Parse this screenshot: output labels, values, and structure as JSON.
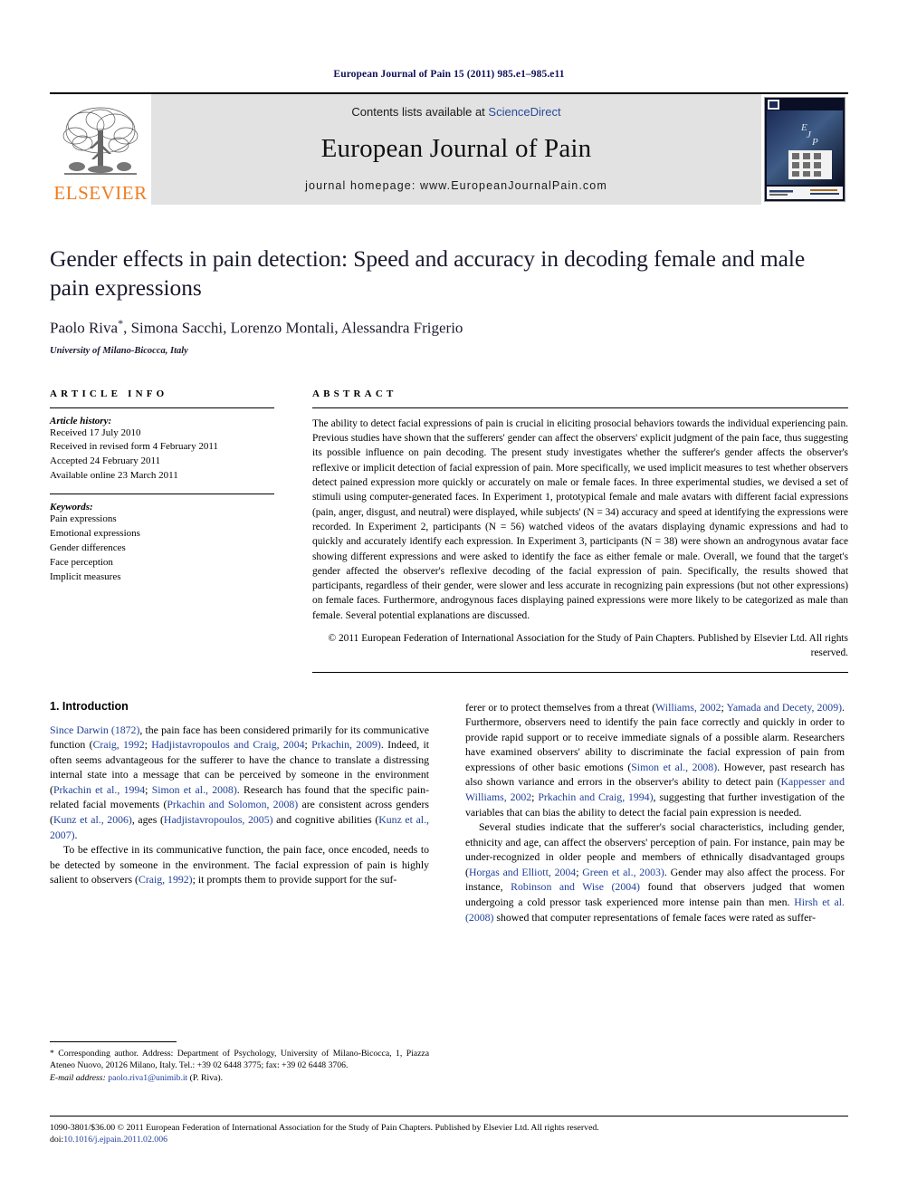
{
  "running_head": "European Journal of Pain 15 (2011) 985.e1–985.e11",
  "masthead": {
    "publisher_name": "ELSEVIER",
    "contents_prefix": "Contents lists available at ",
    "contents_link": "ScienceDirect",
    "journal_name": "European Journal of Pain",
    "homepage": "journal homepage: www.EuropeanJournalPain.com",
    "cover_title_lines": [
      "European",
      "Journal of",
      "Pain"
    ],
    "cover_acronym": "EJP"
  },
  "article": {
    "title": "Gender effects in pain detection: Speed and accuracy in decoding female and male pain expressions",
    "authors": "Paolo Riva",
    "authors_rest": ", Simona Sacchi, Lorenzo Montali, Alessandra Frigerio",
    "corresponding_marker": "*",
    "affiliation": "University of Milano-Bicocca, Italy"
  },
  "article_info": {
    "heading": "ARTICLE INFO",
    "history_label": "Article history:",
    "history": [
      "Received 17 July 2010",
      "Received in revised form 4 February 2011",
      "Accepted 24 February 2011",
      "Available online 23 March 2011"
    ],
    "keywords_label": "Keywords:",
    "keywords": [
      "Pain expressions",
      "Emotional expressions",
      "Gender differences",
      "Face perception",
      "Implicit measures"
    ]
  },
  "abstract": {
    "heading": "ABSTRACT",
    "text": "The ability to detect facial expressions of pain is crucial in eliciting prosocial behaviors towards the individual experiencing pain. Previous studies have shown that the sufferers' gender can affect the observers' explicit judgment of the pain face, thus suggesting its possible influence on pain decoding. The present study investigates whether the sufferer's gender affects the observer's reflexive or implicit detection of facial expression of pain. More specifically, we used implicit measures to test whether observers detect pained expression more quickly or accurately on male or female faces. In three experimental studies, we devised a set of stimuli using computer-generated faces. In Experiment 1, prototypical female and male avatars with different facial expressions (pain, anger, disgust, and neutral) were displayed, while subjects' (N = 34) accuracy and speed at identifying the expressions were recorded. In Experiment 2, participants (N = 56) watched videos of the avatars displaying dynamic expressions and had to quickly and accurately identify each expression. In Experiment 3, participants (N = 38) were shown an androgynous avatar face showing different expressions and were asked to identify the face as either female or male. Overall, we found that the target's gender affected the observer's reflexive decoding of the facial expression of pain. Specifically, the results showed that participants, regardless of their gender, were slower and less accurate in recognizing pain expressions (but not other expressions) on female faces. Furthermore, androgynous faces displaying pained expressions were more likely to be categorized as male than female. Several potential explanations are discussed.",
    "copyright": "© 2011 European Federation of International Association for the Study of Pain Chapters. Published by Elsevier Ltd. All rights reserved."
  },
  "introduction": {
    "heading": "1. Introduction",
    "left_paragraphs": [
      "Since Darwin (1872), the pain face has been considered primarily for its communicative function (Craig, 1992; Hadjistavropoulos and Craig, 2004; Prkachin, 2009). Indeed, it often seems advantageous for the sufferer to have the chance to translate a distressing internal state into a message that can be perceived by someone in the environment (Prkachin et al., 1994; Simon et al., 2008). Research has found that the specific pain-related facial movements (Prkachin and Solomon, 2008) are consistent across genders (Kunz et al., 2006), ages (Hadjistavropoulos, 2005) and cognitive abilities (Kunz et al., 2007).",
      "To be effective in its communicative function, the pain face, once encoded, needs to be detected by someone in the environment. The facial expression of pain is highly salient to observers (Craig, 1992); it prompts them to provide support for the suf-"
    ],
    "right_paragraphs": [
      "ferer or to protect themselves from a threat (Williams, 2002; Yamada and Decety, 2009). Furthermore, observers need to identify the pain face correctly and quickly in order to provide rapid support or to receive immediate signals of a possible alarm. Researchers have examined observers' ability to discriminate the facial expression of pain from expressions of other basic emotions (Simon et al., 2008). However, past research has also shown variance and errors in the observer's ability to detect pain (Kappesser and Williams, 2002; Prkachin and Craig, 1994), suggesting that further investigation of the variables that can bias the ability to detect the facial pain expression is needed.",
      "Several studies indicate that the sufferer's social characteristics, including gender, ethnicity and age, can affect the observers' perception of pain. For instance, pain may be under-recognized in older people and members of ethnically disadvantaged groups (Horgas and Elliott, 2004; Green et al., 2003). Gender may also affect the process. For instance, Robinson and Wise (2004) found that observers judged that women undergoing a cold pressor task experienced more intense pain than men. Hirsh et al. (2008) showed that computer representations of female faces were rated as suffer-"
    ]
  },
  "footnote": {
    "corresponding": "* Corresponding author. Address: Department of Psychology, University of Milano-Bicocca, 1, Piazza Ateneo Nuovo, 20126 Milano, Italy. Tel.: +39 02 6448 3775; fax: +39 02 6448 3706.",
    "email_label": "E-mail address:",
    "email": "paolo.riva1@unimib.it",
    "email_suffix": "(P. Riva)."
  },
  "footer": {
    "issn_line": "1090-3801/$36.00 © 2011 European Federation of International Association for the Study of Pain Chapters. Published by Elsevier Ltd. All rights reserved.",
    "doi_label": "doi:",
    "doi": "10.1016/j.ejpain.2011.02.006"
  },
  "colors": {
    "link_blue": "#21409a",
    "running_head_blue": "#10105a",
    "elsevier_orange": "#ef7d22",
    "masthead_gray": "#e2e2e2"
  }
}
